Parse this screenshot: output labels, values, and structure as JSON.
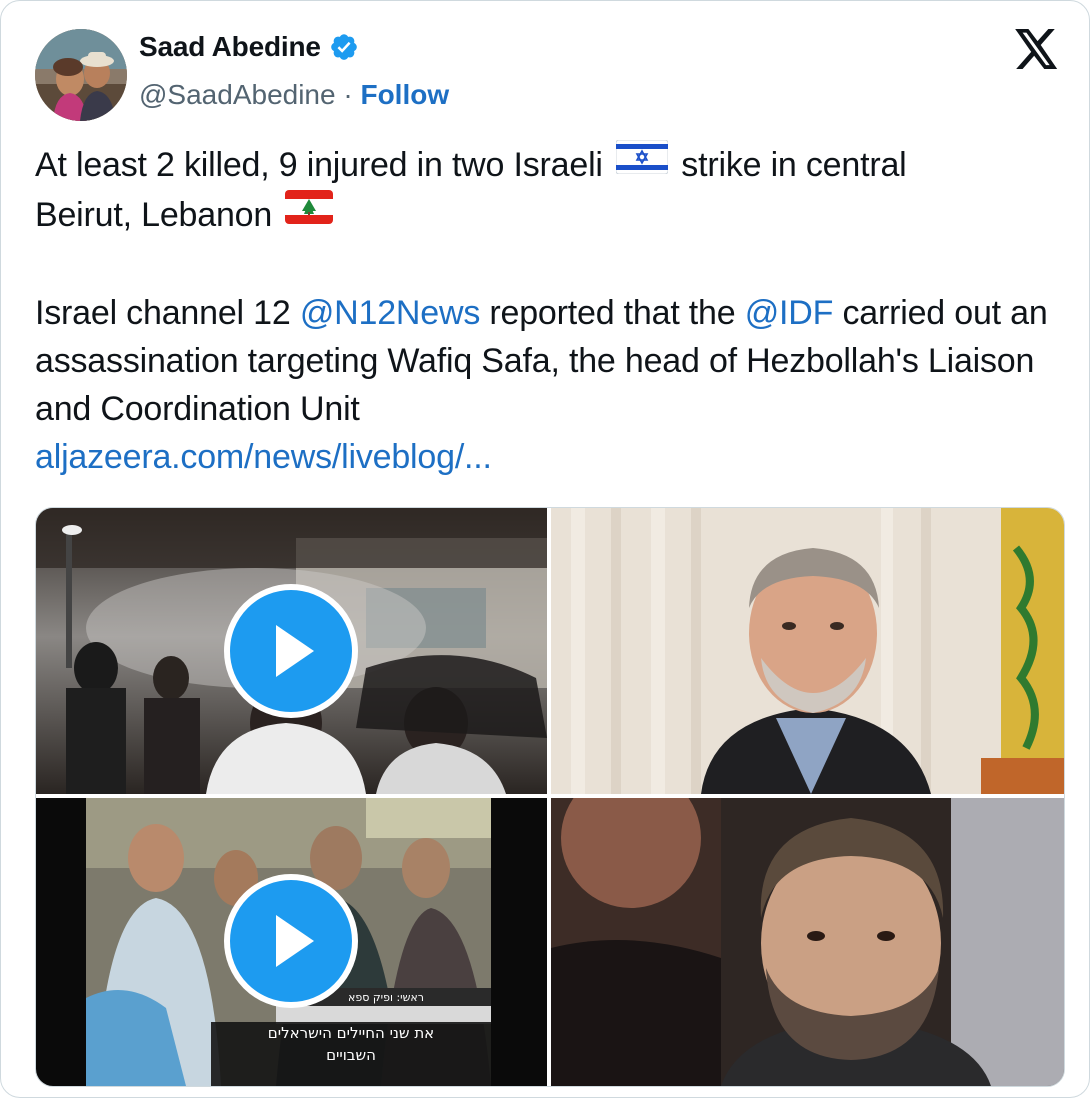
{
  "author": {
    "name": "Saad Abedine",
    "handle": "@SaadAbedine",
    "separator": " · ",
    "follow_label": "Follow",
    "verified": true
  },
  "icons": {
    "avatar": "avatar-photo",
    "verified": "verified-badge-icon",
    "logo": "x-logo-icon",
    "play": "play-icon",
    "israel_flag": "israel-flag-icon",
    "lebanon_flag": "lebanon-flag-icon"
  },
  "tweet": {
    "line1_a": "At least 2 killed, 9 injured in two Israeli",
    "line1_b": "strike in central",
    "line2": "Beirut, Lebanon",
    "p2_a": "Israel channel 12 ",
    "mention_n12": "@N12News",
    "p2_b": " reported that the ",
    "mention_idf": "@IDF",
    "p2_c": "carried out an assassination targeting Wafiq Safa, the head of Hezbollah's Liaison and Coordination Unit",
    "link": "aljazeera.com/news/liveblog/..."
  },
  "media": {
    "tile1": {
      "kind": "video"
    },
    "tile2": {
      "kind": "photo"
    },
    "tile3": {
      "kind": "video",
      "caption_top": "ראשי: ופיק ספא",
      "caption_line1": "את שני החיילים הישראלים",
      "caption_line2": "השבויים"
    },
    "tile4": {
      "kind": "photo"
    }
  },
  "colors": {
    "link": "#1d6fc4",
    "verified": "#1d9bf0",
    "play": "#1d9bf0",
    "text": "#0f1419",
    "secondary": "#536471",
    "border": "#cfd9de"
  }
}
